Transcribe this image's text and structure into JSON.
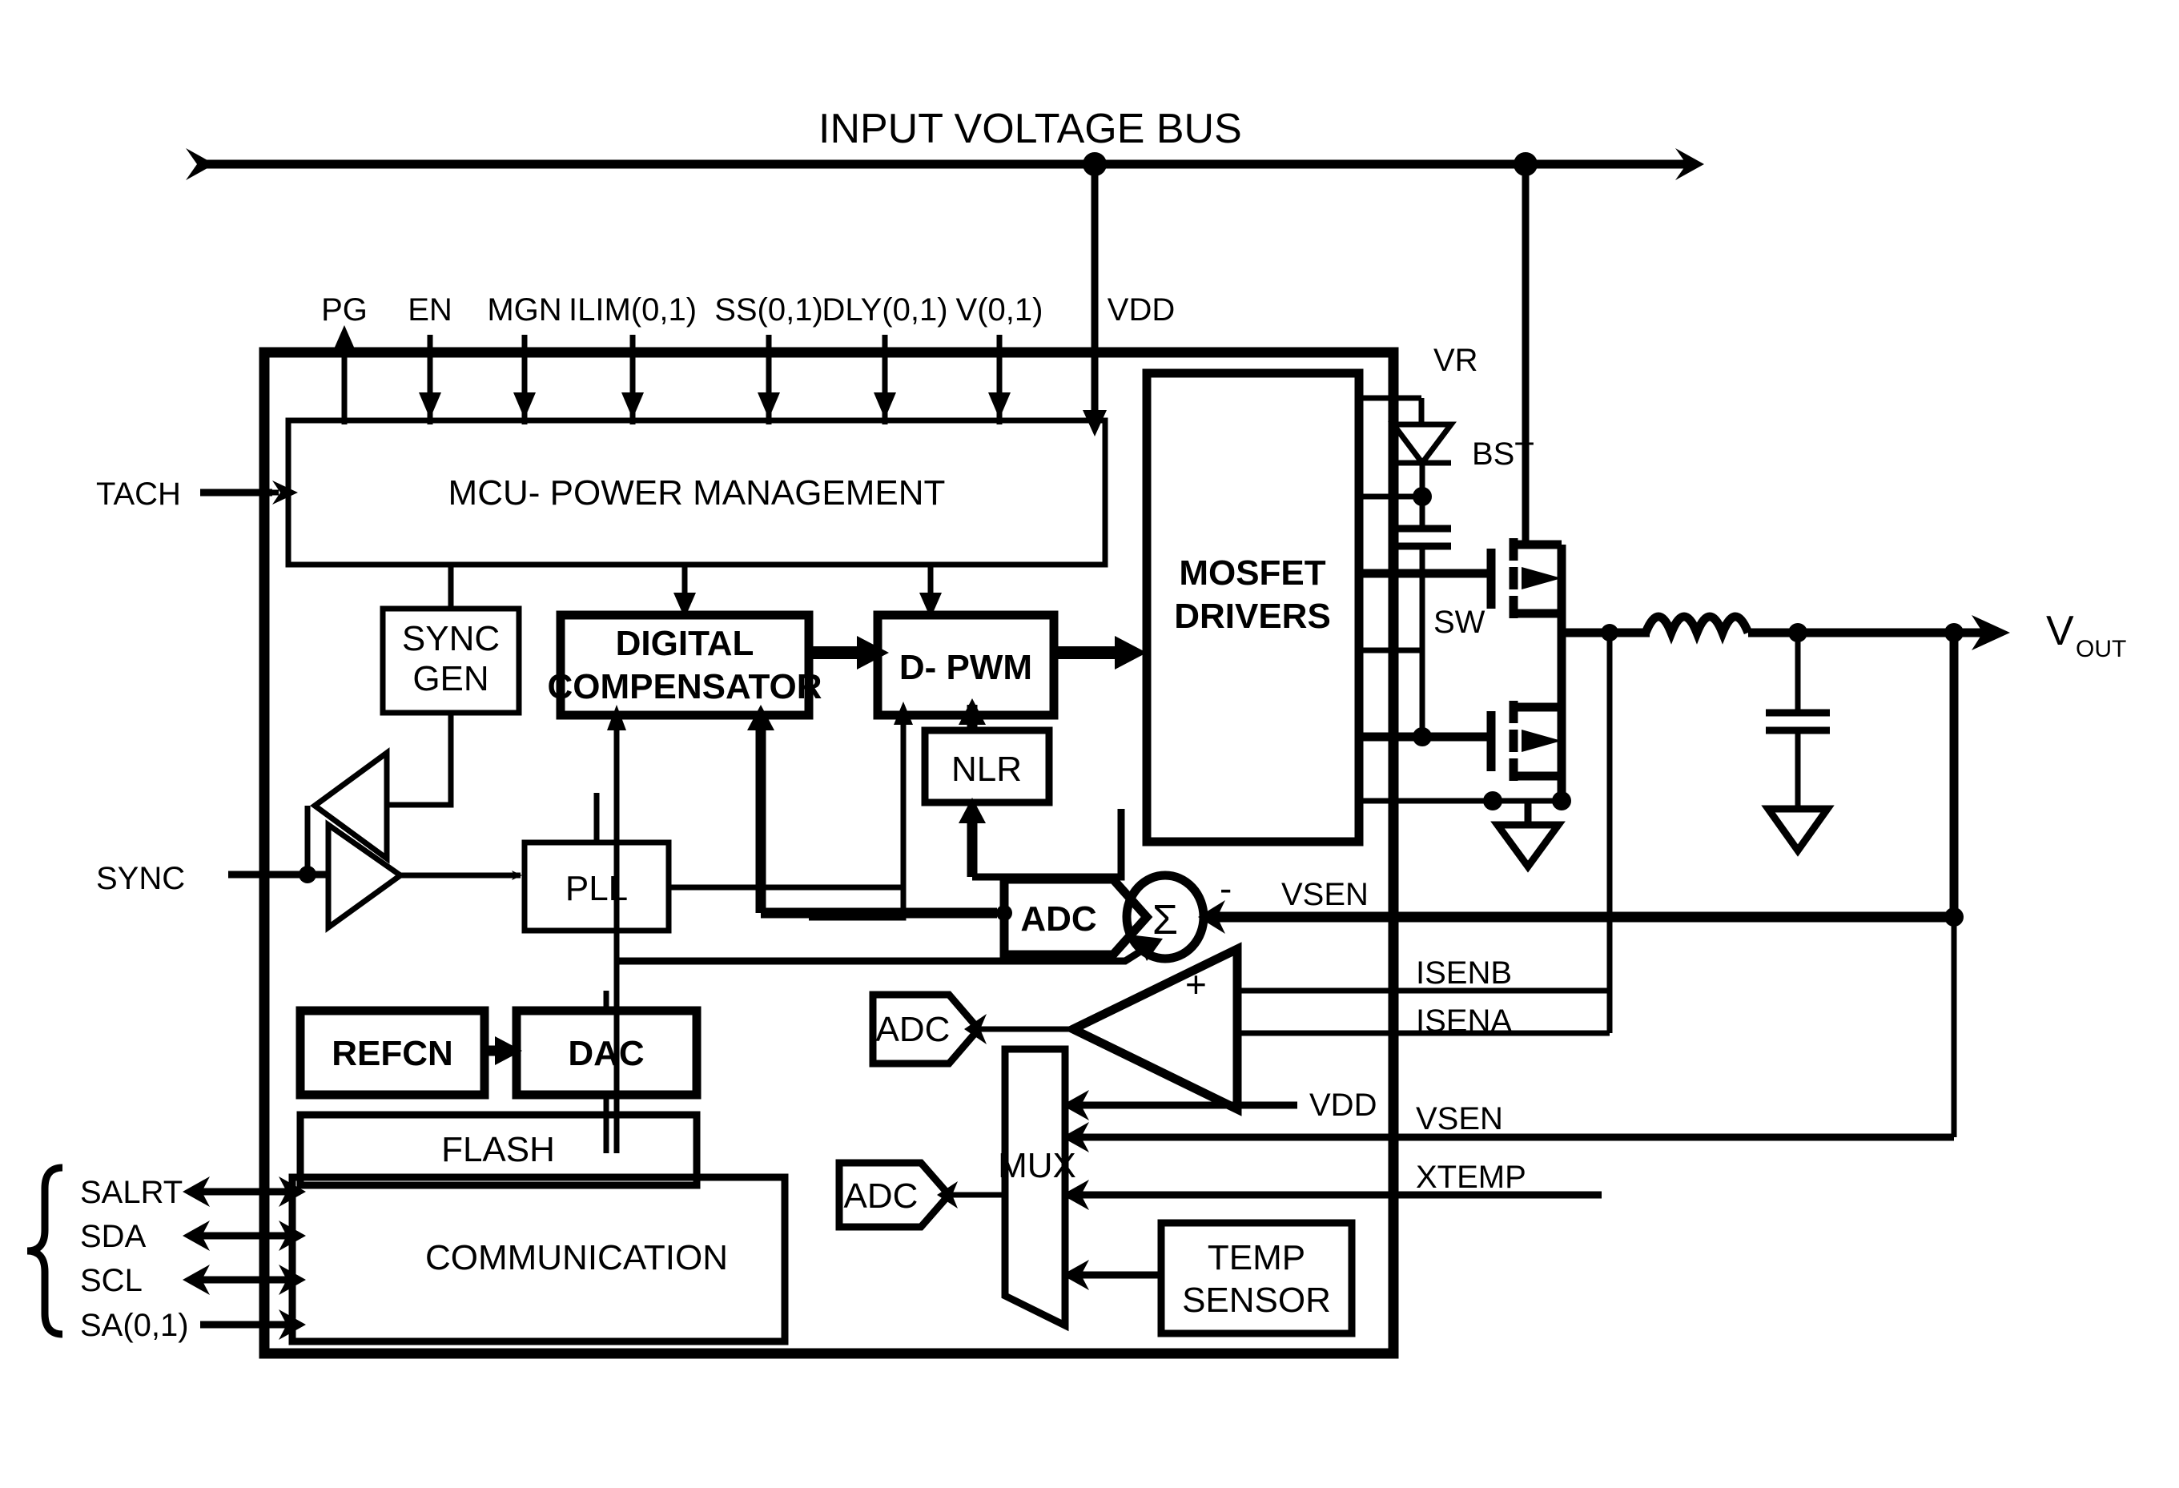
{
  "diagram": {
    "title": "INPUT VOLTAGE BUS",
    "output_label": "V",
    "output_label_sub": "OUT"
  },
  "top_pins": [
    {
      "name": "PG",
      "dir": "out"
    },
    {
      "name": "EN",
      "dir": "in"
    },
    {
      "name": "MGN",
      "dir": "in"
    },
    {
      "name": "ILIM(0,1)",
      "dir": "in"
    },
    {
      "name": "SS(0,1)",
      "dir": "in"
    },
    {
      "name": "DLY(0,1)",
      "dir": "in"
    },
    {
      "name": "V(0,1)",
      "dir": "in"
    },
    {
      "name": "VDD",
      "dir": "in"
    }
  ],
  "left_pins": [
    {
      "name": "TACH",
      "dir": "in"
    },
    {
      "name": "SYNC",
      "dir": "bidir"
    }
  ],
  "comm_pins": [
    {
      "name": "SALRT",
      "dir": "bidir"
    },
    {
      "name": "SDA",
      "dir": "bidir"
    },
    {
      "name": "SCL",
      "dir": "bidir"
    },
    {
      "name": "SA(0,1)",
      "dir": "in"
    }
  ],
  "right_pins": [
    {
      "name": "VR"
    },
    {
      "name": "BST"
    },
    {
      "name": "SW"
    },
    {
      "name": "VSEN"
    },
    {
      "name": "ISENB"
    },
    {
      "name": "ISENA"
    },
    {
      "name": "VDD"
    },
    {
      "name": "VSEN"
    },
    {
      "name": "XTEMP"
    }
  ],
  "blocks": {
    "mcu": "MCU-   POWER MANAGEMENT",
    "sync_gen_l1": "SYNC",
    "sync_gen_l2": "GEN",
    "digcomp_l1": "DIGITAL",
    "digcomp_l2": "COMPENSATOR",
    "dpwm": "D- PWM",
    "nlr": "NLR",
    "pll": "PLL",
    "drivers_l1": "MOSFET",
    "drivers_l2": "DRIVERS",
    "refcn": "REFCN",
    "dac": "DAC",
    "flash": "FLASH",
    "communication": "COMMUNICATION",
    "mux": "MUX",
    "temp_l1": "TEMP",
    "temp_l2": "SENSOR",
    "adc_fb": "ADC",
    "adc_isen": "ADC",
    "adc_mux": "ADC",
    "summer": "Σ",
    "summer_minus": "-",
    "summer_plus": "+"
  },
  "colors": {
    "ink": "#000000",
    "paper": "#ffffff"
  }
}
